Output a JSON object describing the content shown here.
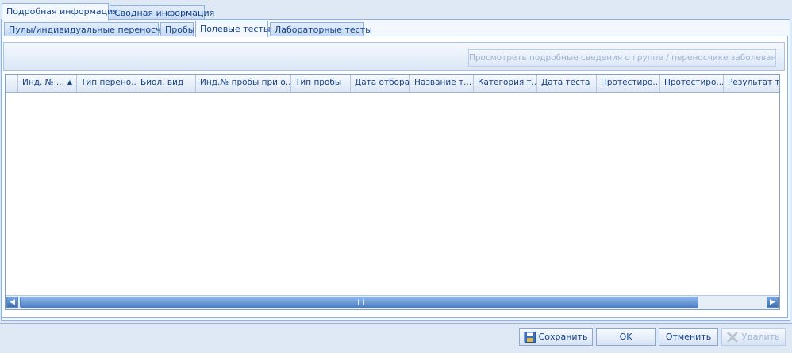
{
  "top_tabs": [
    {
      "label": "Подробная информация",
      "active": true
    },
    {
      "label": "Сводная информация",
      "active": false
    }
  ],
  "sub_tabs": [
    {
      "label": "Пулы/индивидуальные переносчики",
      "active": false
    },
    {
      "label": "Пробы",
      "active": false
    },
    {
      "label": "Полевые тесты",
      "active": true
    },
    {
      "label": "Лабораторные тесты",
      "active": false
    }
  ],
  "toolbar": {
    "view_details_label": "Просмотреть подробные сведения о группе / переносчике заболевания",
    "view_details_enabled": false
  },
  "grid": {
    "columns": [
      {
        "label": "Инд. № ...",
        "sorted": "ascending"
      },
      {
        "label": "Тип перено..."
      },
      {
        "label": "Биол. вид"
      },
      {
        "label": "Инд.№ пробы при о..."
      },
      {
        "label": "Тип пробы"
      },
      {
        "label": "Дата отбора"
      },
      {
        "label": "Название т..."
      },
      {
        "label": "Категория т..."
      },
      {
        "label": "Дата теста"
      },
      {
        "label": "Протестиро..."
      },
      {
        "label": "Протестиро..."
      },
      {
        "label": "Результат т..."
      }
    ],
    "rows": [],
    "scroll_left_icon": "chevron-left-icon",
    "scroll_right_icon": "chevron-right-icon"
  },
  "footer": {
    "save_label": "Сохранить",
    "ok_label": "OK",
    "cancel_label": "Отменить",
    "delete_label": "Удалить",
    "delete_enabled": false
  },
  "colors": {
    "background": "#dfe9f5",
    "text": "#15428b",
    "border": "#8db2e3",
    "disabled_text": "#9fb5d3"
  }
}
